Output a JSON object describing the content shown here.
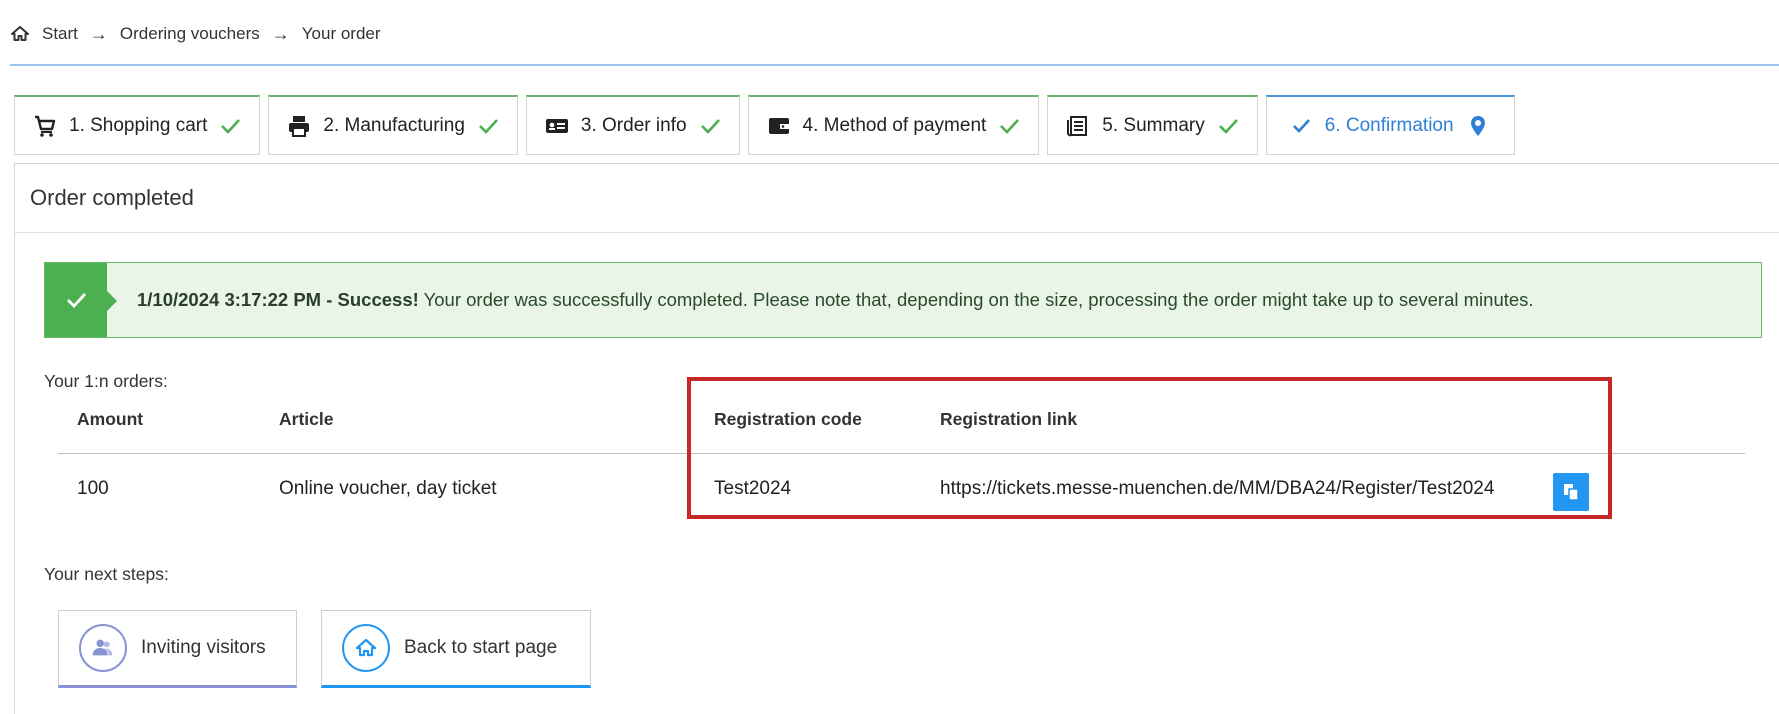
{
  "breadcrumb": {
    "items": [
      "Start",
      "Ordering vouchers",
      "Your order"
    ],
    "separator": "→"
  },
  "tabs": [
    {
      "label": "1. Shopping cart",
      "icon": "cart-icon",
      "status": "done"
    },
    {
      "label": "2. Manufacturing",
      "icon": "printer-icon",
      "status": "done"
    },
    {
      "label": "3. Order info",
      "icon": "id-card-icon",
      "status": "done"
    },
    {
      "label": "4. Method of payment",
      "icon": "wallet-icon",
      "status": "done"
    },
    {
      "label": "5. Summary",
      "icon": "document-icon",
      "status": "done"
    },
    {
      "label": "6. Confirmation",
      "icon": "map-pin-icon",
      "status": "active"
    }
  ],
  "panel": {
    "title": "Order completed"
  },
  "alert": {
    "timestamp_bold": "1/10/2024 3:17:22 PM - Success!",
    "message": " Your order was successfully completed. Please note that, depending on the size, processing the order might take up to several minutes."
  },
  "orders": {
    "label": "Your 1:n orders:",
    "columns": [
      "Amount",
      "Article",
      "Registration code",
      "Registration link"
    ],
    "rows": [
      {
        "amount": "100",
        "article": "Online voucher, day ticket",
        "code": "Test2024",
        "link": "https://tickets.messe-muenchen.de/MM/DBA24/Register/Test2024"
      }
    ]
  },
  "next_steps": {
    "label": "Your next steps:",
    "buttons": [
      {
        "label": "Inviting visitors",
        "icon": "people-icon"
      },
      {
        "label": "Back to start page",
        "icon": "home-icon"
      }
    ]
  },
  "colors": {
    "done_check": "#4caf50",
    "active_tab": "#2f80d6",
    "alert_bg": "#e8f5e8",
    "highlight": "#c62828",
    "copy_button": "#2196f3"
  }
}
